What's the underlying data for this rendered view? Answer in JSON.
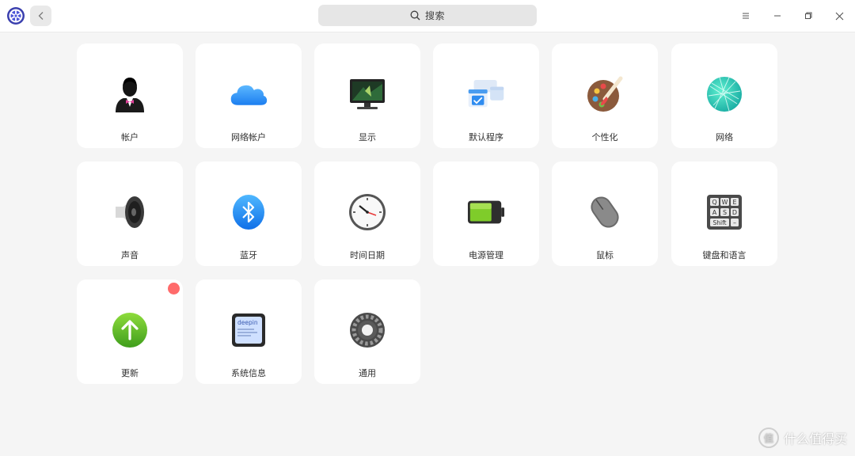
{
  "header": {
    "search_label": "搜索",
    "app_logo_icon": "deepin-control-center-icon",
    "back_icon": "chevron-left-icon",
    "menu_icon": "hamburger-menu-icon",
    "minimize_icon": "minimize-icon",
    "restore_icon": "restore-icon",
    "close_icon": "close-icon"
  },
  "tiles": [
    {
      "label": "帐户",
      "icon": "accounts-icon"
    },
    {
      "label": "网络帐户",
      "icon": "cloud-icon"
    },
    {
      "label": "显示",
      "icon": "monitor-icon"
    },
    {
      "label": "默认程序",
      "icon": "default-apps-icon"
    },
    {
      "label": "个性化",
      "icon": "palette-icon"
    },
    {
      "label": "网络",
      "icon": "network-globe-icon"
    },
    {
      "label": "声音",
      "icon": "speaker-icon"
    },
    {
      "label": "蓝牙",
      "icon": "bluetooth-icon"
    },
    {
      "label": "时间日期",
      "icon": "clock-icon"
    },
    {
      "label": "电源管理",
      "icon": "battery-icon"
    },
    {
      "label": "鼠标",
      "icon": "mouse-icon"
    },
    {
      "label": "键盘和语言",
      "icon": "keyboard-icon"
    },
    {
      "label": "更新",
      "icon": "update-arrow-icon",
      "has_badge": true
    },
    {
      "label": "系统信息",
      "icon": "system-info-icon"
    },
    {
      "label": "通用",
      "icon": "gear-icon"
    }
  ],
  "keyboard_keys": [
    "Q",
    "W",
    "E",
    "A",
    "S",
    "D",
    "Shift",
    "–"
  ],
  "sysinfo_text": "deepin",
  "colors": {
    "accent": "#2e7ff0",
    "badge": "#ff6b6b",
    "tile_bg": "#ffffff",
    "page_bg": "#f5f5f5"
  },
  "watermark": {
    "text": "什么值得买",
    "mark": "值"
  }
}
